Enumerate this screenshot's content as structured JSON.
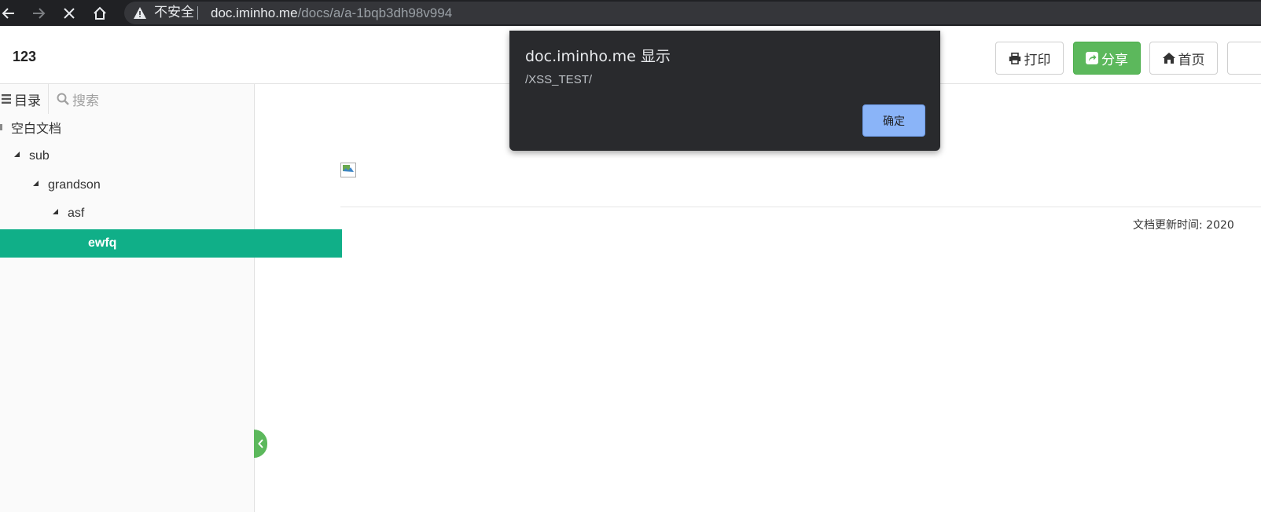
{
  "browser": {
    "insecure_label": "不安全",
    "url_host": "doc.iminho.me",
    "url_path": "/docs/a/a-1bqb3dh98v994"
  },
  "header": {
    "doc_title": "123",
    "print_label": "打印",
    "share_label": "分享",
    "home_label": "首页"
  },
  "sidebar": {
    "toc_tab_label": "目录",
    "search_placeholder": "搜索",
    "tree": [
      {
        "label": "空白文档",
        "level": 0
      },
      {
        "label": "sub",
        "level": 1,
        "expanded": true
      },
      {
        "label": "grandson",
        "level": 2,
        "expanded": true
      },
      {
        "label": "asf",
        "level": 3,
        "expanded": true
      },
      {
        "label": "ewfq",
        "level": 4,
        "selected": true
      }
    ]
  },
  "content": {
    "update_time_label": "文档更新时间: 2020"
  },
  "alert": {
    "title": "doc.iminho.me 显示",
    "message": "/XSS_TEST/",
    "ok_label": "确定"
  },
  "colors": {
    "accent_green": "#5cb85c",
    "tree_selected": "#10af88",
    "dialog_bg": "#292a2d",
    "dialog_button": "#8ab4f8"
  }
}
